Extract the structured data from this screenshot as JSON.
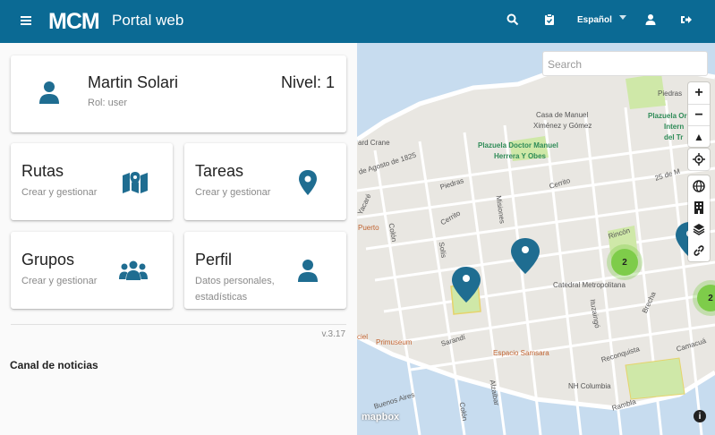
{
  "header": {
    "logo_text": "MCM",
    "title": "Portal web",
    "language": "Español"
  },
  "user": {
    "name": "Martin Solari",
    "role": "Rol: user",
    "level": "Nivel: 1"
  },
  "menu": [
    {
      "title": "Rutas",
      "subtitle": "Crear y gestionar",
      "icon": "map-icon"
    },
    {
      "title": "Tareas",
      "subtitle": "Crear y gestionar",
      "icon": "location-pin-icon"
    },
    {
      "title": "Grupos",
      "subtitle": "Crear y gestionar",
      "icon": "group-icon"
    },
    {
      "title": "Perfil",
      "subtitle": "Datos personales, estadísticas",
      "icon": "person-icon"
    }
  ],
  "version": "v.3.17",
  "news": {
    "title": "Canal de noticias"
  },
  "map": {
    "search_placeholder": "Search",
    "attribution": "mapbox",
    "labels": {
      "l1": "Piedras",
      "l2": "Plazuela Or",
      "l3": "Intern",
      "l4": "del Tr",
      "l5": "Casa de Manuel",
      "l6": "Ximénez y Gómez",
      "l7": "ard Crane",
      "l8": "Plazuela Doctor Manuel",
      "l9": "Herrera Y Obes",
      "l10": "de Agosto de 1825",
      "l11": "25 de M",
      "l12": "Yacaré",
      "l13": "Colón",
      "l14": "Piedras",
      "l15": "Misiones",
      "l16": "Cerrito",
      "l17": "Cerrito",
      "l18": "Puerto",
      "l19": "Solís",
      "l20": "Rincón",
      "l21": "Catedral Metropolitana",
      "l22": "Ituzaingó",
      "l23": "Brecha",
      "l24": "Primuseum",
      "l25": "Sarandí",
      "l26": "Espacio Samsara",
      "l27": "Reconquista",
      "l28": "Camacuá",
      "l29": "NH Columbia",
      "l30": "Buenos Aires",
      "l31": "Alzaibar",
      "l32": "Colón",
      "l33": "Rambla",
      "l34": "ciel"
    },
    "clusters": [
      "2",
      "2"
    ]
  }
}
